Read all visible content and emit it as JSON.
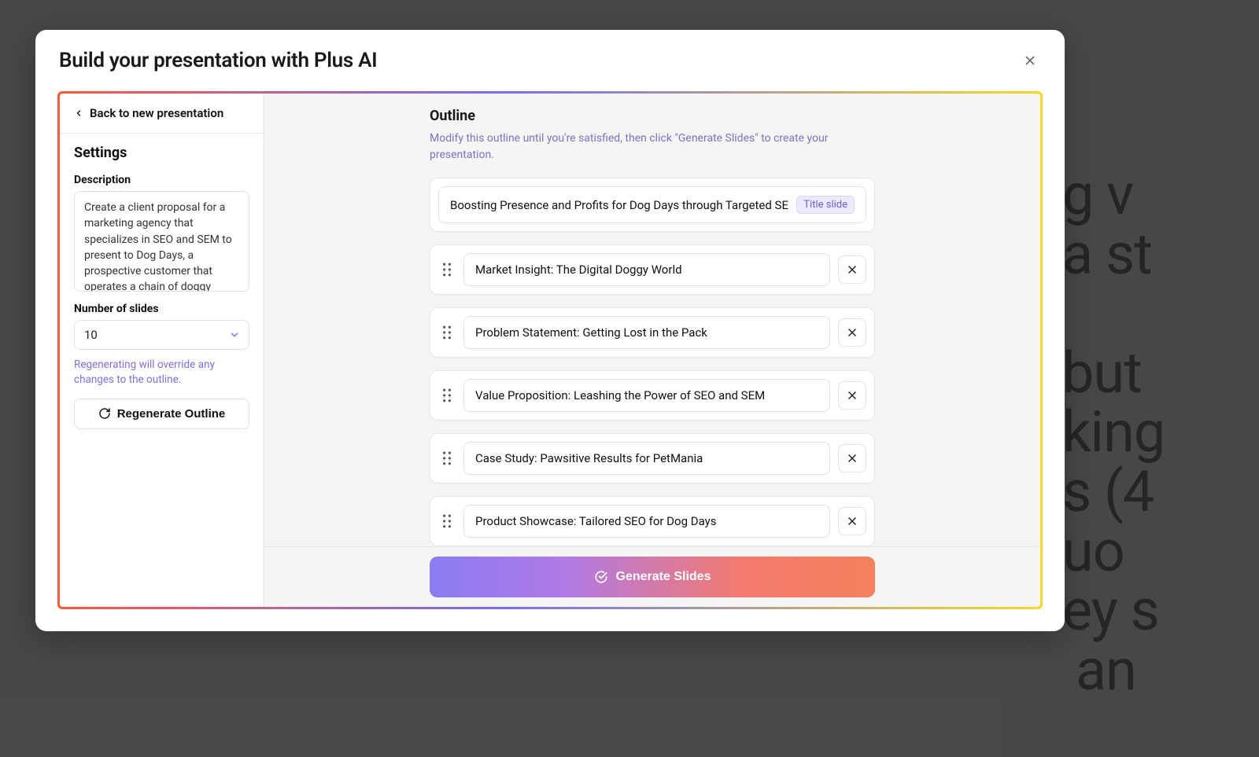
{
  "bg_peek_text": "g v\na st\n\nbut\nking\ns (4\nuo\ney s\n an",
  "modal": {
    "title": "Build your presentation with Plus AI"
  },
  "sidebar": {
    "back_label": "Back to new presentation",
    "settings_heading": "Settings",
    "description_label": "Description",
    "description_value": "Create a client proposal for a marketing agency that specializes in SEO and SEM to present to Dog Days, a prospective customer that operates a chain of doggy daycares",
    "slides_label": "Number of slides",
    "slides_value": "10",
    "regen_hint": "Regenerating will override any changes to the outline.",
    "regen_button": "Regenerate Outline"
  },
  "outline": {
    "heading": "Outline",
    "subheading": "Modify this outline until you're satisfied, then click \"Generate Slides\" to create your presentation.",
    "title_slide": {
      "text": "Boosting Presence and Profits for Dog Days through Targeted SEO",
      "badge": "Title slide"
    },
    "slides": [
      {
        "title": "Market Insight: The Digital Doggy World"
      },
      {
        "title": "Problem Statement: Getting Lost in the Pack"
      },
      {
        "title": "Value Proposition: Leashing the Power of SEO and SEM"
      },
      {
        "title": "Case Study: Pawsitive Results for PetMania"
      },
      {
        "title": "Product Showcase: Tailored SEO for Dog Days"
      }
    ]
  },
  "footer": {
    "generate_label": "Generate Slides"
  }
}
